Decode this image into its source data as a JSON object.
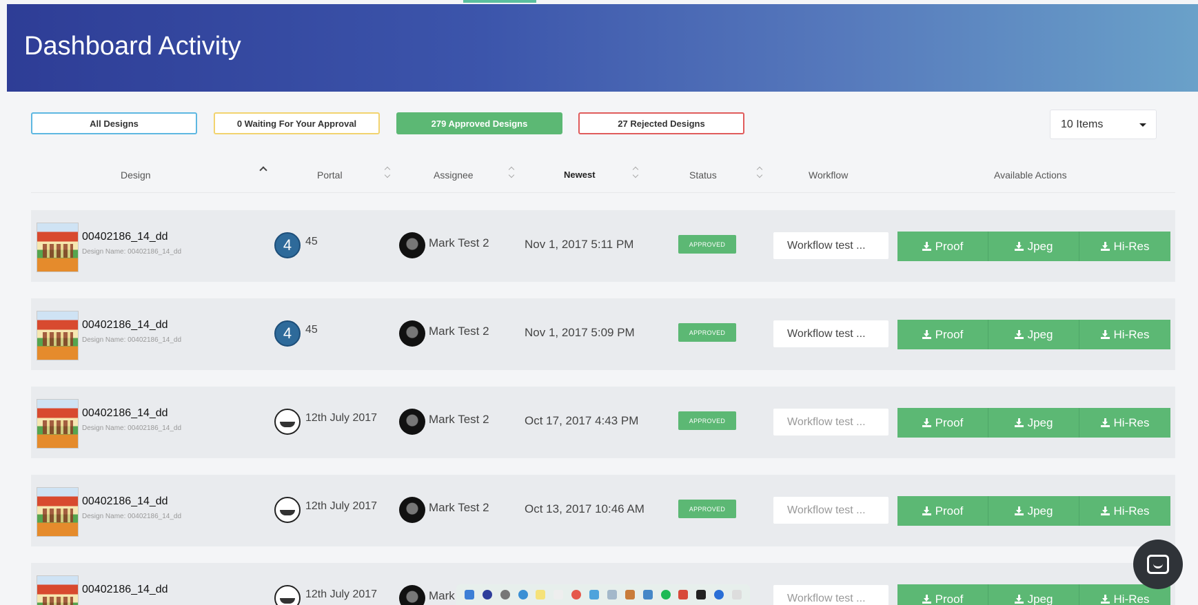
{
  "header": {
    "title": "Dashboard Activity"
  },
  "filters": {
    "all": "All Designs",
    "waiting": "0 Waiting For Your Approval",
    "approved": "279 Approved Designs",
    "rejected": "27 Rejected Designs"
  },
  "items_select": {
    "value": "10 Items"
  },
  "columns": {
    "design": "Design",
    "portal": "Portal",
    "assignee": "Assignee",
    "newest": "Newest",
    "status": "Status",
    "workflow": "Workflow",
    "actions": "Available Actions"
  },
  "rows": [
    {
      "title": "00402186_14_dd",
      "subtitle": "Design Name: 00402186_14_dd",
      "portal_icon": "4",
      "portal": "45",
      "assignee": "Mark Test 2",
      "date": "Nov 1, 2017 5:11 PM",
      "status": "APPROVED",
      "workflow": "Workflow test ...",
      "actions": [
        "Proof",
        "Jpeg",
        "Hi-Res"
      ]
    },
    {
      "title": "00402186_14_dd",
      "subtitle": "Design Name: 00402186_14_dd",
      "portal_icon": "4",
      "portal": "45",
      "assignee": "Mark Test 2",
      "date": "Nov 1, 2017 5:09 PM",
      "status": "APPROVED",
      "workflow": "Workflow test ...",
      "actions": [
        "Proof",
        "Jpeg",
        "Hi-Res"
      ]
    },
    {
      "title": "00402186_14_dd",
      "subtitle": "Design Name: 00402186_14_dd",
      "portal_icon": "",
      "portal": "12th July 2017",
      "assignee": "Mark Test 2",
      "date": "Oct 17, 2017 4:43 PM",
      "status": "APPROVED",
      "workflow": "Workflow test ...",
      "actions": [
        "Proof",
        "Jpeg",
        "Hi-Res"
      ]
    },
    {
      "title": "00402186_14_dd",
      "subtitle": "Design Name: 00402186_14_dd",
      "portal_icon": "",
      "portal": "12th July 2017",
      "assignee": "Mark Test 2",
      "date": "Oct 13, 2017 10:46 AM",
      "status": "APPROVED",
      "workflow": "Workflow test ...",
      "actions": [
        "Proof",
        "Jpeg",
        "Hi-Res"
      ]
    },
    {
      "title": "00402186_14_dd",
      "subtitle": "",
      "portal_icon": "",
      "portal": "12th July 2017",
      "assignee": "Mark",
      "date": "",
      "status": "",
      "workflow": "Workflow test ...",
      "actions": [
        "Proof",
        "Jpeg",
        "Hi-Res"
      ]
    }
  ],
  "colors": {
    "header_start": "#2e3d96",
    "header_end": "#6aa1c9",
    "approved": "#5cb874",
    "rejected": "#e05b5b",
    "waiting": "#f2d36e",
    "all": "#5db7e1"
  },
  "icons": {
    "download": "download-icon",
    "chat": "chat-bubble-icon"
  }
}
